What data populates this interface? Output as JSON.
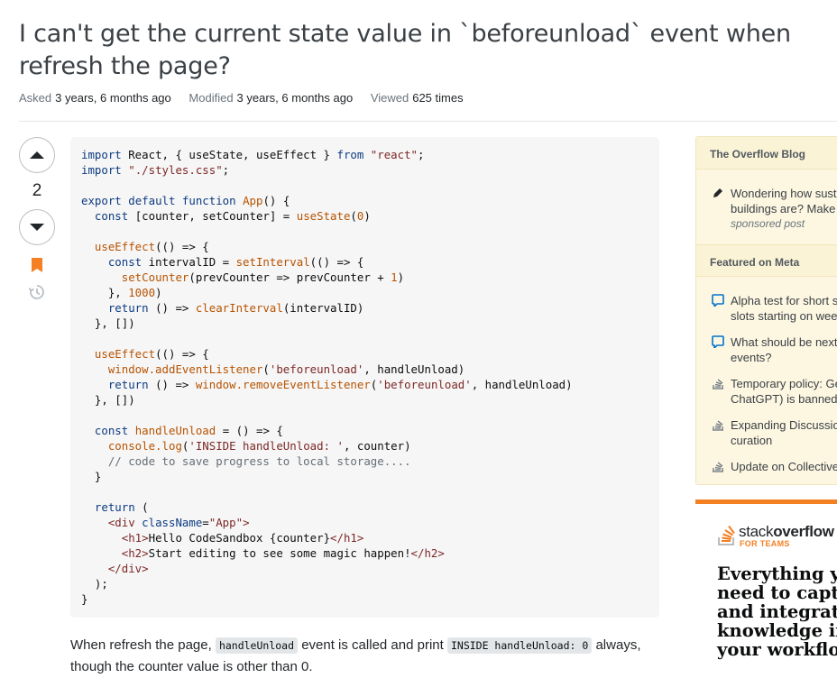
{
  "question": {
    "title": "I can't get the current state value in `beforeunload` event when refresh the page?",
    "asked_label": "Asked",
    "asked_value": "3 years, 6 months ago",
    "modified_label": "Modified",
    "modified_value": "3 years, 6 months ago",
    "viewed_label": "Viewed",
    "viewed_value": "625 times",
    "vote_count": "2",
    "body": {
      "p1_a": "When refresh the page, ",
      "p1_code1": "handleUnload",
      "p1_b": " event is called and print ",
      "p1_code2": "INSIDE handleUnload: 0",
      "p1_c": " always,",
      "p1_d": "though the counter value is other than 0."
    }
  },
  "sidebar": {
    "blog_heading": "The Overflow Blog",
    "blog_items": [
      {
        "text": "Wondering how sust",
        "text2": "buildings are? Make",
        "sub": "sponsored post",
        "icon": "pencil-icon"
      }
    ],
    "meta_heading": "Featured on Meta",
    "meta_items": [
      {
        "line1": "Alpha test for short s",
        "line2": "slots starting on wee",
        "icon": "chat-bubble-icon"
      },
      {
        "line1": "What should be next",
        "line2": "events?",
        "icon": "chat-bubble-icon"
      },
      {
        "line1": "Temporary policy: Ge",
        "line2": "ChatGPT) is banned",
        "icon": "stack-icon"
      },
      {
        "line1": "Expanding Discussio",
        "line2": "curation",
        "icon": "stack-icon"
      },
      {
        "line1": "Update on Collective",
        "line2": "",
        "icon": "stack-icon"
      }
    ]
  },
  "ad": {
    "brand_light": "stack",
    "brand_bold": "overflow",
    "brand_sub": "FOR TEAMS",
    "headline": "Everything yo\nneed to captur\nand integrate A\nknowledge int\nyour workflow"
  },
  "colors": {
    "accent": "#f48024",
    "sidebar_bg": "#fdf7e2",
    "code_bg": "#f6f6f6",
    "keyword": "#0c3b82",
    "string": "#7d2727"
  }
}
